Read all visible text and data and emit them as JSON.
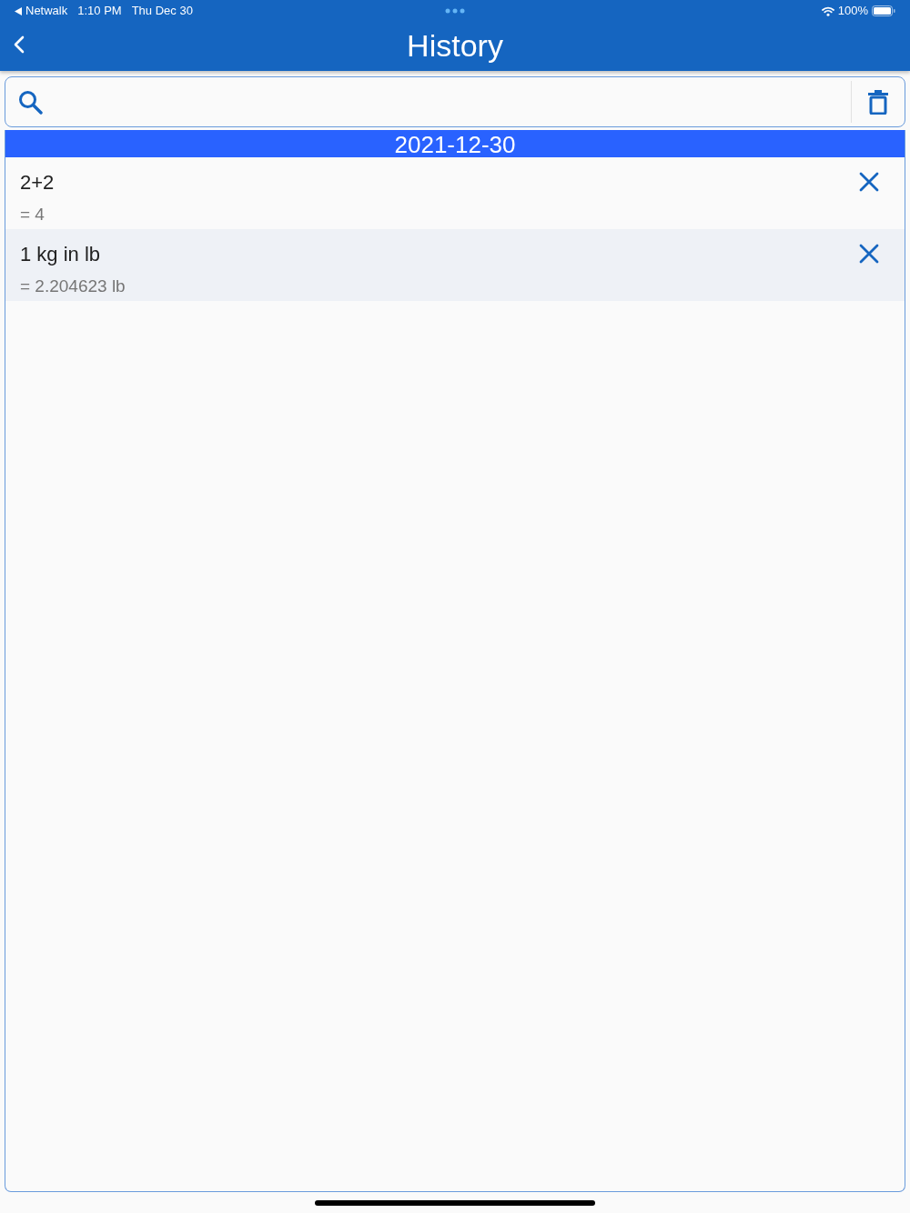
{
  "status_bar": {
    "back_app": "Netwalk",
    "time": "1:10 PM",
    "date": "Thu Dec 30",
    "battery": "100%"
  },
  "nav_bar": {
    "title": "History"
  },
  "groups": [
    {
      "date": "2021-12-30",
      "entries": [
        {
          "expression": "2+2",
          "result": "= 4"
        },
        {
          "expression": "1 kg in lb",
          "result": "= 2.204623 lb"
        }
      ]
    }
  ]
}
